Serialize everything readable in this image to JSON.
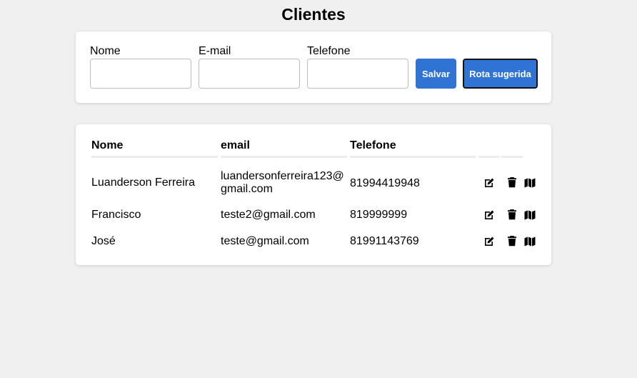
{
  "page": {
    "title": "Clientes"
  },
  "form": {
    "fields": [
      {
        "label": "Nome",
        "value": ""
      },
      {
        "label": "E-mail",
        "value": ""
      },
      {
        "label": "Telefone",
        "value": ""
      }
    ],
    "save_label": "Salvar",
    "route_label": "Rota sugerida",
    "accent_color": "#2f73d4"
  },
  "table": {
    "headers": [
      "Nome",
      "email",
      "Telefone"
    ],
    "rows": [
      {
        "name": "Luanderson Ferreira",
        "email_line1": "luandersonferreira123@",
        "email_line2": "gmail.com",
        "phone": "81994419948"
      },
      {
        "name": "Francisco",
        "email_line1": "teste2@gmail.com",
        "email_line2": "",
        "phone": "819999999"
      },
      {
        "name": "José",
        "email_line1": "teste@gmail.com",
        "email_line2": "",
        "phone": "81991143769"
      }
    ],
    "row_actions": [
      "edit-icon",
      "trash-icon",
      "map-icon"
    ]
  }
}
